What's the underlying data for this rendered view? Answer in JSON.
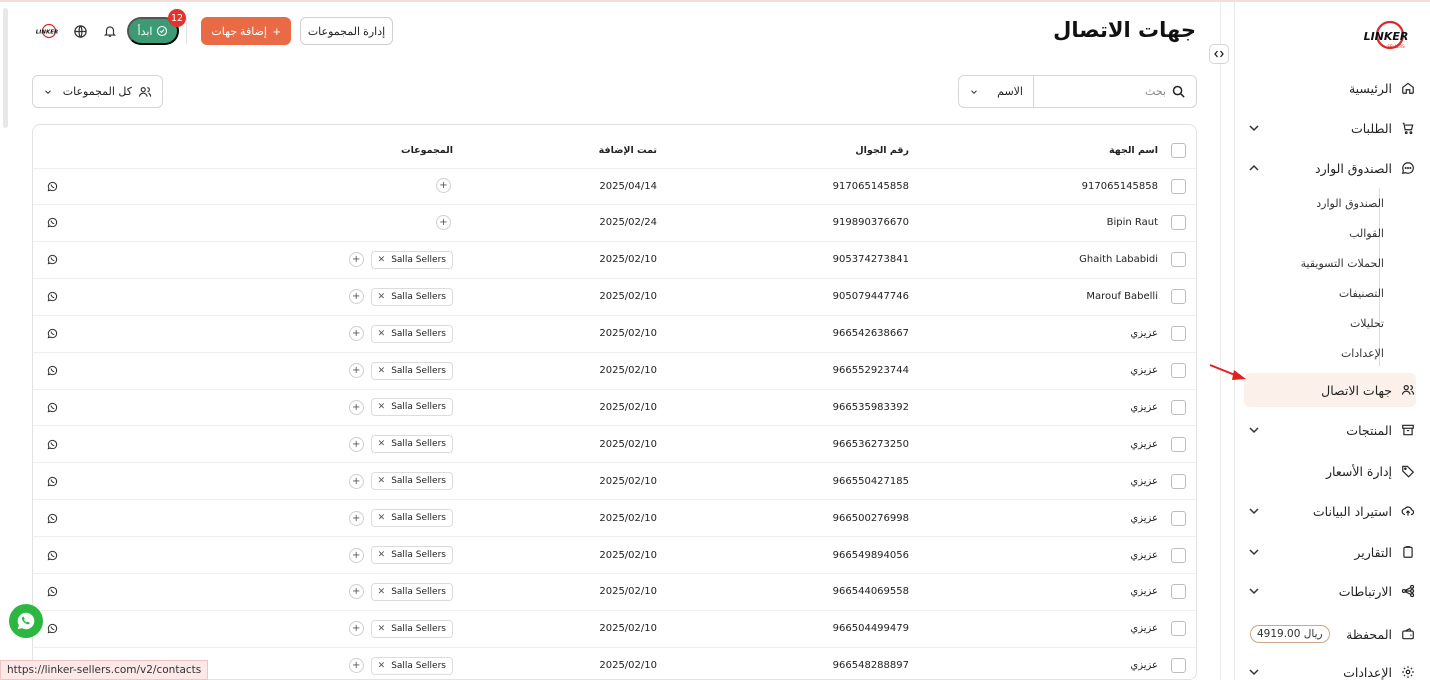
{
  "app": {
    "brand": "LINKER",
    "url": "https://linker-sellers.com/v2/contacts"
  },
  "sidebar": {
    "items": [
      {
        "label": "الرئيسية",
        "icon": "home-icon"
      },
      {
        "label": "الطلبات",
        "icon": "cart-icon",
        "expandable": true
      },
      {
        "label": "الصندوق الوارد",
        "icon": "chat-icon",
        "expanded": true
      },
      {
        "label": "جهات الاتصال",
        "icon": "users-icon",
        "active": true
      },
      {
        "label": "المنتجات",
        "icon": "archive-icon",
        "expandable": true
      },
      {
        "label": "إدارة الأسعار",
        "icon": "tag-icon"
      },
      {
        "label": "استيراد البيانات",
        "icon": "upload-cloud-icon",
        "expandable": true
      },
      {
        "label": "التقارير",
        "icon": "clipboard-icon",
        "expandable": true
      },
      {
        "label": "الارتباطات",
        "icon": "share-icon",
        "expandable": true
      },
      {
        "label": "المحفظة",
        "icon": "wallet-icon"
      },
      {
        "label": "الإعدادات",
        "icon": "gear-icon",
        "expandable": true
      }
    ],
    "inbox_subitems": [
      "الصندوق الوارد",
      "القوالب",
      "الحملات التسويقية",
      "التصنيفات",
      "تحليلات",
      "الإعدادات"
    ],
    "wallet_balance": "4919.00 ريال"
  },
  "header": {
    "title": "جهات الاتصال",
    "manage_groups_label": "إدارة المجموعات",
    "add_contacts_label": "إضافة جهات",
    "start_label": "ابدأ",
    "notification_count": "12"
  },
  "search": {
    "placeholder": "بحث",
    "field_select": "الاسم"
  },
  "filters": {
    "groups_select": "كل المجموعات"
  },
  "table": {
    "columns": {
      "name": "اسم الجهة",
      "phone": "رقم الجوال",
      "added": "تمت الإضافة",
      "groups": "المجموعات"
    },
    "rows": [
      {
        "name": "917065145858",
        "phone": "917065145858",
        "added": "2025/04/14",
        "group": ""
      },
      {
        "name": "Bipin Raut",
        "phone": "919890376670",
        "added": "2025/02/24",
        "group": ""
      },
      {
        "name": "Ghaith Lababidi",
        "phone": "905374273841",
        "added": "2025/02/10",
        "group": "Salla Sellers"
      },
      {
        "name": "Marouf Babelli",
        "phone": "905079447746",
        "added": "2025/02/10",
        "group": "Salla Sellers"
      },
      {
        "name": "عزيزي",
        "phone": "966542638667",
        "added": "2025/02/10",
        "group": "Salla Sellers"
      },
      {
        "name": "عزيزي",
        "phone": "966552923744",
        "added": "2025/02/10",
        "group": "Salla Sellers"
      },
      {
        "name": "عزيزي",
        "phone": "966535983392",
        "added": "2025/02/10",
        "group": "Salla Sellers"
      },
      {
        "name": "عزيزي",
        "phone": "966536273250",
        "added": "2025/02/10",
        "group": "Salla Sellers"
      },
      {
        "name": "عزيزي",
        "phone": "966550427185",
        "added": "2025/02/10",
        "group": "Salla Sellers"
      },
      {
        "name": "عزيزي",
        "phone": "966500276998",
        "added": "2025/02/10",
        "group": "Salla Sellers"
      },
      {
        "name": "عزيزي",
        "phone": "966549894056",
        "added": "2025/02/10",
        "group": "Salla Sellers"
      },
      {
        "name": "عزيزي",
        "phone": "966544069558",
        "added": "2025/02/10",
        "group": "Salla Sellers"
      },
      {
        "name": "عزيزي",
        "phone": "966504499479",
        "added": "2025/02/10",
        "group": "Salla Sellers"
      },
      {
        "name": "عزيزي",
        "phone": "966548288897",
        "added": "2025/02/10",
        "group": "Salla Sellers"
      }
    ]
  },
  "colors": {
    "accent": "#e86b45",
    "start": "#3c9b74",
    "active_nav_bg": "#fbf1ea",
    "badge": "#e0342c",
    "whatsapp": "#2bb741"
  }
}
